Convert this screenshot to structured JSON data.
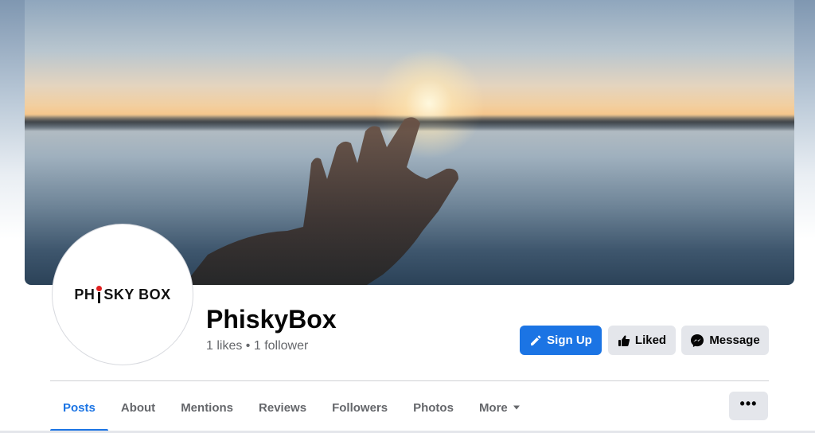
{
  "page": {
    "name": "PhiskyBox",
    "stats": "1 likes • 1 follower",
    "logo": {
      "part1": "PH",
      "part2": "SKY BOX",
      "accent_color": "#e02020"
    }
  },
  "actions": {
    "signup_label": "Sign Up",
    "liked_label": "Liked",
    "message_label": "Message"
  },
  "tabs": [
    {
      "label": "Posts",
      "active": true
    },
    {
      "label": "About"
    },
    {
      "label": "Mentions"
    },
    {
      "label": "Reviews"
    },
    {
      "label": "Followers"
    },
    {
      "label": "Photos"
    },
    {
      "label": "More",
      "icon": "caret-down-icon"
    }
  ],
  "overflow": {
    "label": "•••",
    "icon": "ellipsis-icon"
  },
  "colors": {
    "accent": "#1b74e4",
    "button_secondary": "#e4e6eb",
    "text_secondary": "#65676b"
  },
  "cover": {
    "description_icon": "sunset-hand-cover-photo"
  }
}
